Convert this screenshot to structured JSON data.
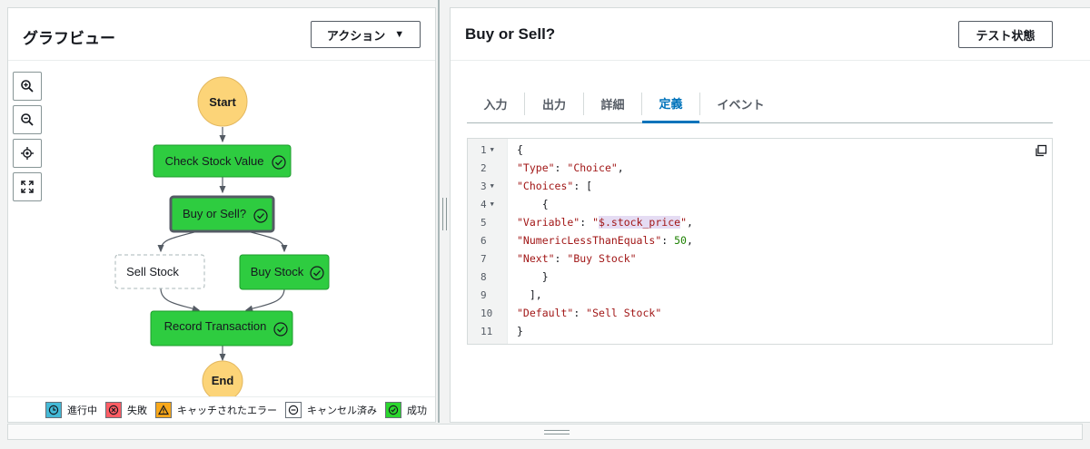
{
  "left_panel": {
    "title": "グラフビュー",
    "action_button": "アクション",
    "zoom_controls": [
      {
        "name": "zoom-in-icon"
      },
      {
        "name": "zoom-out-icon"
      },
      {
        "name": "center-icon"
      },
      {
        "name": "fit-icon"
      }
    ],
    "graph": {
      "nodes": {
        "start": "Start",
        "check": "Check Stock Value",
        "choice": "Buy or Sell?",
        "sell": "Sell Stock",
        "buy": "Buy Stock",
        "record": "Record Transaction",
        "end": "End"
      },
      "colors": {
        "success": "#2ecc40",
        "terminal": "#fcd478",
        "edge": "#545b64"
      }
    },
    "legend": [
      {
        "label": "進行中",
        "color": "#44b9d6",
        "icon": "clock-icon"
      },
      {
        "label": "失敗",
        "color": "#ff5d64",
        "icon": "x-circle-icon"
      },
      {
        "label": "キャッチされたエラー",
        "color": "#f7a81b",
        "icon": "warning-icon"
      },
      {
        "label": "キャンセル済み",
        "color": "#ffffff",
        "icon": "minus-circle-icon"
      },
      {
        "label": "成功",
        "color": "#2bd62e",
        "icon": "check-circle-icon"
      }
    ]
  },
  "right_panel": {
    "title": "Buy or Sell?",
    "test_state_button": "テスト状態",
    "tabs": [
      {
        "label": "入力",
        "active": false
      },
      {
        "label": "出力",
        "active": false
      },
      {
        "label": "詳細",
        "active": false
      },
      {
        "label": "定義",
        "active": true
      },
      {
        "label": "イベント",
        "active": false
      }
    ],
    "code": {
      "line_numbers": [
        "1",
        "2",
        "3",
        "4",
        "5",
        "6",
        "7",
        "8",
        "9",
        "10",
        "11"
      ],
      "lines": [
        "{",
        "  \"Type\": \"Choice\",",
        "  \"Choices\": [",
        "    {",
        "      \"Variable\": \"$.stock_price\",",
        "      \"NumericLessThanEquals\": 50,",
        "      \"Next\": \"Buy Stock\"",
        "    }",
        "  ],",
        "  \"Default\": \"Sell Stock\"",
        "}"
      ]
    }
  }
}
